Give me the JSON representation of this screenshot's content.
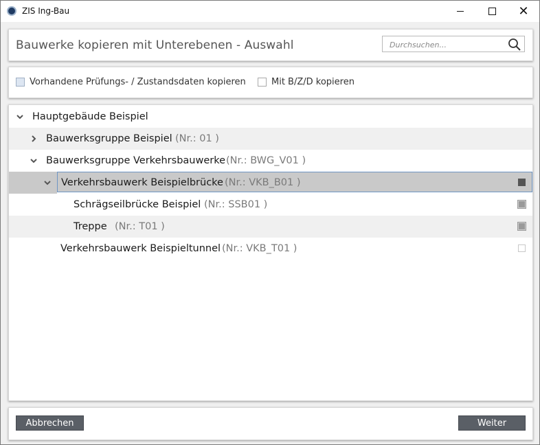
{
  "window": {
    "title": "ZIS Ing-Bau"
  },
  "header": {
    "title": "Bauwerke kopieren mit Unterebenen - Auswahl"
  },
  "search": {
    "placeholder": "Durchsuchen..."
  },
  "options": {
    "copy_inspection_data": {
      "label": "Vorhandene Prüfungs- / Zustandsdaten kopieren",
      "checked": false
    },
    "copy_bzd": {
      "label": "Mit B/Z/D kopieren",
      "checked": false
    }
  },
  "tree": [
    {
      "label": "Hauptgebäude Beispiel",
      "number": "",
      "expander": "expanded",
      "state": ""
    },
    {
      "label": "Bauwerksgruppe Beispiel",
      "number": "(Nr.: 01 )",
      "expander": "collapsed",
      "state": ""
    },
    {
      "label": "Bauwerksgruppe Verkehrsbauwerke",
      "number": "(Nr.: BWG_V01 )",
      "expander": "expanded",
      "state": ""
    },
    {
      "label": "Verkehrsbauwerk Beispielbrücke",
      "number": "(Nr.: VKB_B01 )",
      "expander": "expanded",
      "state": "selected"
    },
    {
      "label": "Schrägseilbrücke Beispiel",
      "number": "(Nr.: SSB01 )",
      "expander": "none",
      "state": "selected"
    },
    {
      "label": "Treppe",
      "number": "(Nr.: T01 )",
      "expander": "none",
      "state": "selected"
    },
    {
      "label": "Verkehrsbauwerk Beispieltunnel",
      "number": "(Nr.: VKB_T01 )",
      "expander": "none",
      "state": "unselected"
    }
  ],
  "footer": {
    "cancel_label": "Abbrechen",
    "next_label": "Weiter"
  },
  "icons": [
    "app-icon",
    "minimize-icon",
    "maximize-icon",
    "close-icon",
    "search-icon",
    "chevron-down-icon",
    "chevron-right-icon"
  ],
  "colors": {
    "button": "#5a5f66",
    "selection": "#c9c9c9",
    "selection_border": "#6e95c4"
  }
}
